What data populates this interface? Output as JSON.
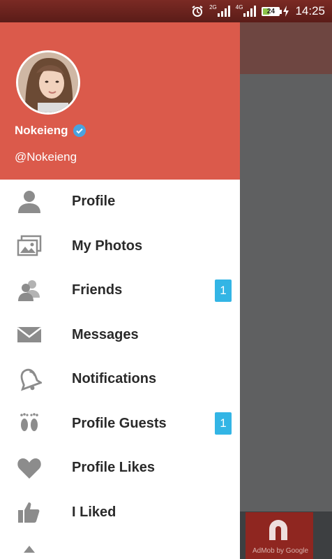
{
  "status_bar": {
    "sig1_label": "2G",
    "sig2_label": "4G",
    "battery": "24",
    "time": "14:25"
  },
  "drawer": {
    "user": {
      "name": "Nokeieng",
      "handle": "@Nokeieng"
    },
    "items": [
      {
        "label": "Profile",
        "icon": "person-icon"
      },
      {
        "label": "My Photos",
        "icon": "photos-icon"
      },
      {
        "label": "Friends",
        "icon": "friends-icon",
        "badge": "1"
      },
      {
        "label": "Messages",
        "icon": "envelope-icon"
      },
      {
        "label": "Notifications",
        "icon": "bell-icon"
      },
      {
        "label": "Profile Guests",
        "icon": "footprints-icon",
        "badge": "1"
      },
      {
        "label": "Profile Likes",
        "icon": "heart-icon"
      },
      {
        "label": "I Liked",
        "icon": "thumbs-up-icon"
      }
    ]
  },
  "ad": {
    "text": "AdMob by Google"
  },
  "colors": {
    "header": "#db5a4b",
    "badge": "#33b5e5",
    "icon": "#8c8c8c"
  }
}
